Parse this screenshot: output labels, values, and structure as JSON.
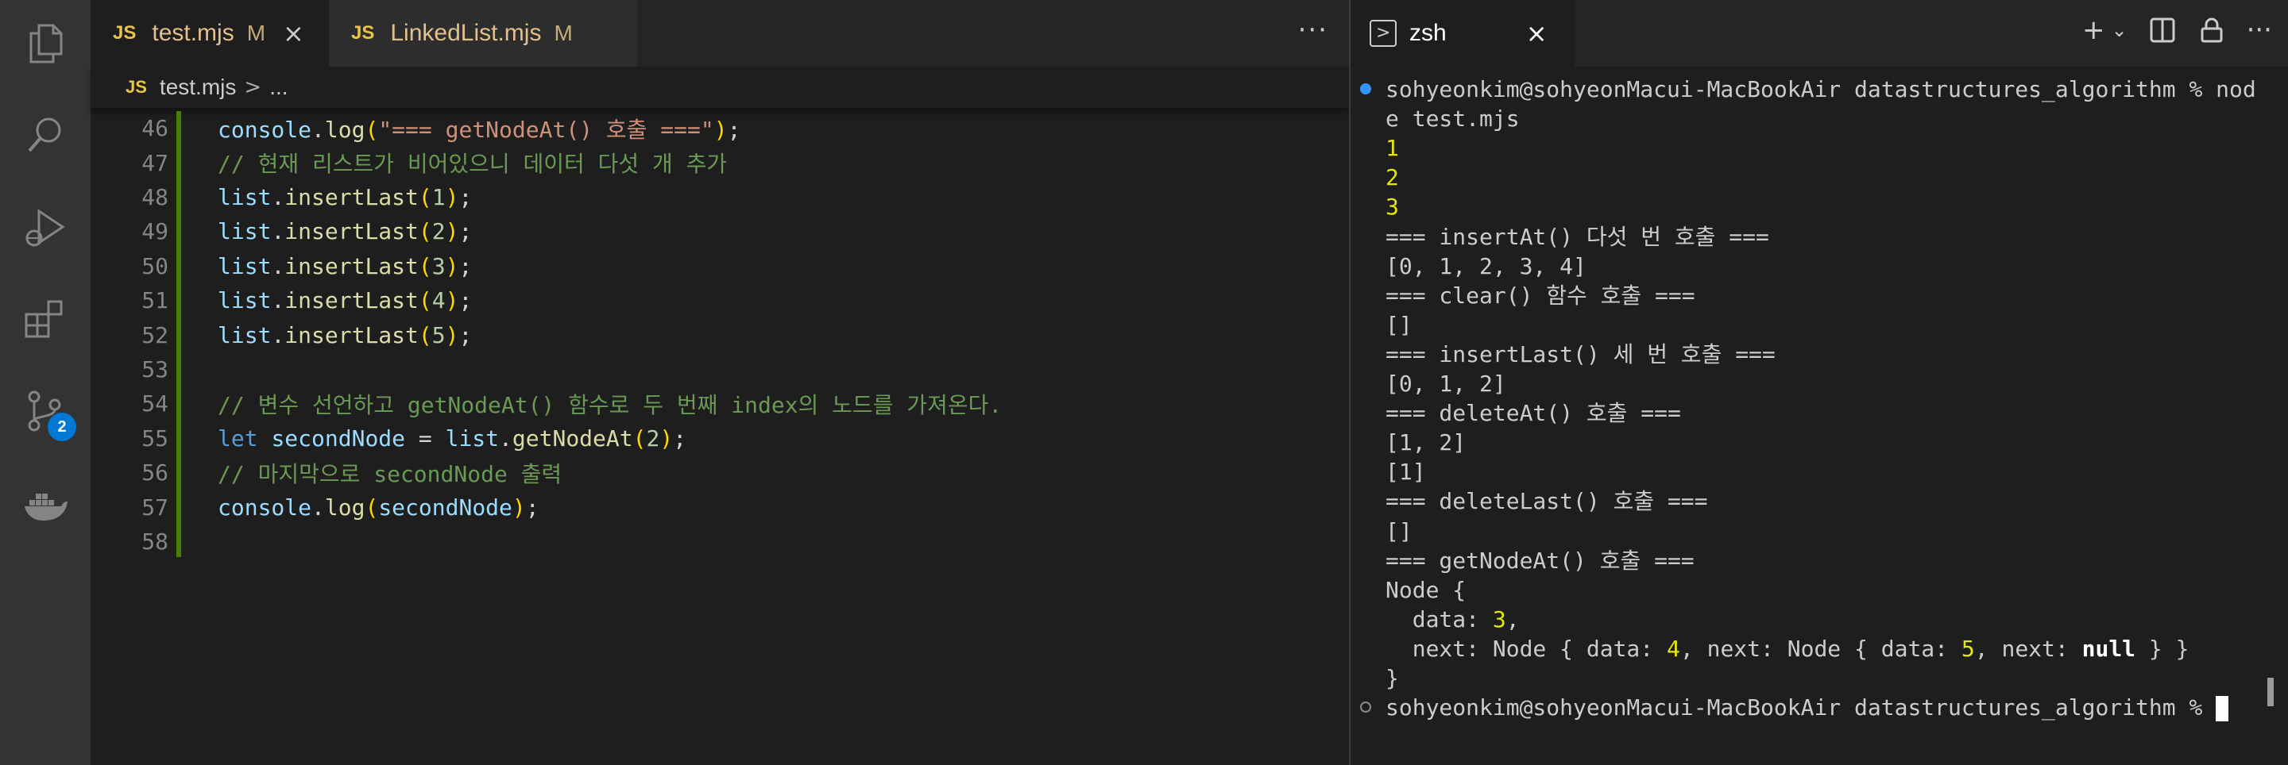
{
  "editor": {
    "tabs": [
      {
        "badge": "JS",
        "name": "test.mjs",
        "status": "M",
        "close": "×"
      },
      {
        "badge": "JS",
        "name": "LinkedList.mjs",
        "status": "M"
      }
    ],
    "more": "···",
    "breadcrumb": {
      "badge": "JS",
      "file": "test.mjs",
      "sep": ">",
      "rest": "..."
    },
    "line_numbers": [
      "46",
      "47",
      "48",
      "49",
      "50",
      "51",
      "52",
      "53",
      "54",
      "55",
      "56",
      "57",
      "58"
    ],
    "lines": [
      [
        {
          "t": "console",
          "c": "v"
        },
        {
          "t": ".",
          "c": "p"
        },
        {
          "t": "log",
          "c": "f"
        },
        {
          "t": "(",
          "c": "b"
        },
        {
          "t": "\"=== getNodeAt() 호출 ===\"",
          "c": "s"
        },
        {
          "t": ")",
          "c": "b"
        },
        {
          "t": ";",
          "c": "p"
        }
      ],
      [
        {
          "t": "// 현재 리스트가 비어있으니 데이터 다섯 개 추가",
          "c": "c"
        }
      ],
      [
        {
          "t": "list",
          "c": "v"
        },
        {
          "t": ".",
          "c": "p"
        },
        {
          "t": "insertLast",
          "c": "f"
        },
        {
          "t": "(",
          "c": "b"
        },
        {
          "t": "1",
          "c": "n"
        },
        {
          "t": ")",
          "c": "b"
        },
        {
          "t": ";",
          "c": "p"
        }
      ],
      [
        {
          "t": "list",
          "c": "v"
        },
        {
          "t": ".",
          "c": "p"
        },
        {
          "t": "insertLast",
          "c": "f"
        },
        {
          "t": "(",
          "c": "b"
        },
        {
          "t": "2",
          "c": "n"
        },
        {
          "t": ")",
          "c": "b"
        },
        {
          "t": ";",
          "c": "p"
        }
      ],
      [
        {
          "t": "list",
          "c": "v"
        },
        {
          "t": ".",
          "c": "p"
        },
        {
          "t": "insertLast",
          "c": "f"
        },
        {
          "t": "(",
          "c": "b"
        },
        {
          "t": "3",
          "c": "n"
        },
        {
          "t": ")",
          "c": "b"
        },
        {
          "t": ";",
          "c": "p"
        }
      ],
      [
        {
          "t": "list",
          "c": "v"
        },
        {
          "t": ".",
          "c": "p"
        },
        {
          "t": "insertLast",
          "c": "f"
        },
        {
          "t": "(",
          "c": "b"
        },
        {
          "t": "4",
          "c": "n"
        },
        {
          "t": ")",
          "c": "b"
        },
        {
          "t": ";",
          "c": "p"
        }
      ],
      [
        {
          "t": "list",
          "c": "v"
        },
        {
          "t": ".",
          "c": "p"
        },
        {
          "t": "insertLast",
          "c": "f"
        },
        {
          "t": "(",
          "c": "b"
        },
        {
          "t": "5",
          "c": "n"
        },
        {
          "t": ")",
          "c": "b"
        },
        {
          "t": ";",
          "c": "p"
        }
      ],
      [],
      [
        {
          "t": "// 변수 선언하고 getNodeAt() 함수로 두 번째 index의 노드를 가져온다.",
          "c": "c"
        }
      ],
      [
        {
          "t": "let",
          "c": "k"
        },
        {
          "t": " ",
          "c": "p"
        },
        {
          "t": "secondNode",
          "c": "v"
        },
        {
          "t": " = ",
          "c": "p"
        },
        {
          "t": "list",
          "c": "v"
        },
        {
          "t": ".",
          "c": "p"
        },
        {
          "t": "getNodeAt",
          "c": "f"
        },
        {
          "t": "(",
          "c": "b"
        },
        {
          "t": "2",
          "c": "n"
        },
        {
          "t": ")",
          "c": "b"
        },
        {
          "t": ";",
          "c": "p"
        }
      ],
      [
        {
          "t": "// 마지막으로 secondNode 출력",
          "c": "c"
        }
      ],
      [
        {
          "t": "console",
          "c": "v"
        },
        {
          "t": ".",
          "c": "p"
        },
        {
          "t": "log",
          "c": "f"
        },
        {
          "t": "(",
          "c": "b"
        },
        {
          "t": "secondNode",
          "c": "v"
        },
        {
          "t": ")",
          "c": "b"
        },
        {
          "t": ";",
          "c": "p"
        }
      ],
      []
    ]
  },
  "activity": {
    "badge_count": "2"
  },
  "terminal": {
    "tab_name": "zsh",
    "close": "×",
    "actions": {
      "add": "+",
      "dropdown": "⌄",
      "more": "···"
    },
    "lines": [
      [
        {
          "t": "sohyeonkim@sohyeonMacui-MacBookAir datastructures_algorithm % nod",
          "c": "t"
        }
      ],
      [
        {
          "t": "e test.mjs",
          "c": "t"
        }
      ],
      [
        {
          "t": "1",
          "c": "y"
        }
      ],
      [
        {
          "t": "2",
          "c": "y"
        }
      ],
      [
        {
          "t": "3",
          "c": "y"
        }
      ],
      [
        {
          "t": "=== insertAt() 다섯 번 호출 ===",
          "c": "t"
        }
      ],
      [
        {
          "t": "[0, 1, 2, 3, 4]",
          "c": "t"
        }
      ],
      [
        {
          "t": "=== clear() 함수 호출 ===",
          "c": "t"
        }
      ],
      [
        {
          "t": "[]",
          "c": "t"
        }
      ],
      [
        {
          "t": "=== insertLast() 세 번 호출 ===",
          "c": "t"
        }
      ],
      [
        {
          "t": "[0, 1, 2]",
          "c": "t"
        }
      ],
      [
        {
          "t": "=== deleteAt() 호출 ===",
          "c": "t"
        }
      ],
      [
        {
          "t": "[1, 2]",
          "c": "t"
        }
      ],
      [
        {
          "t": "[1]",
          "c": "t"
        }
      ],
      [
        {
          "t": "=== deleteLast() 호출 ===",
          "c": "t"
        }
      ],
      [
        {
          "t": "[]",
          "c": "t"
        }
      ],
      [
        {
          "t": "=== getNodeAt() 호출 ===",
          "c": "t"
        }
      ],
      [
        {
          "t": "Node {",
          "c": "t"
        }
      ],
      [
        {
          "t": "  data: ",
          "c": "t"
        },
        {
          "t": "3",
          "c": "y"
        },
        {
          "t": ",",
          "c": "t"
        }
      ],
      [
        {
          "t": "  next: Node { data: ",
          "c": "t"
        },
        {
          "t": "4",
          "c": "y"
        },
        {
          "t": ", next: Node { data: ",
          "c": "t"
        },
        {
          "t": "5",
          "c": "y"
        },
        {
          "t": ", next: ",
          "c": "t"
        },
        {
          "t": "null",
          "c": "w"
        },
        {
          "t": " } }",
          "c": "t"
        }
      ],
      [
        {
          "t": "}",
          "c": "t"
        }
      ],
      [
        {
          "t": "sohyeonkim@sohyeonMacui-MacBookAir datastructures_algorithm % ",
          "c": "t"
        }
      ]
    ]
  }
}
